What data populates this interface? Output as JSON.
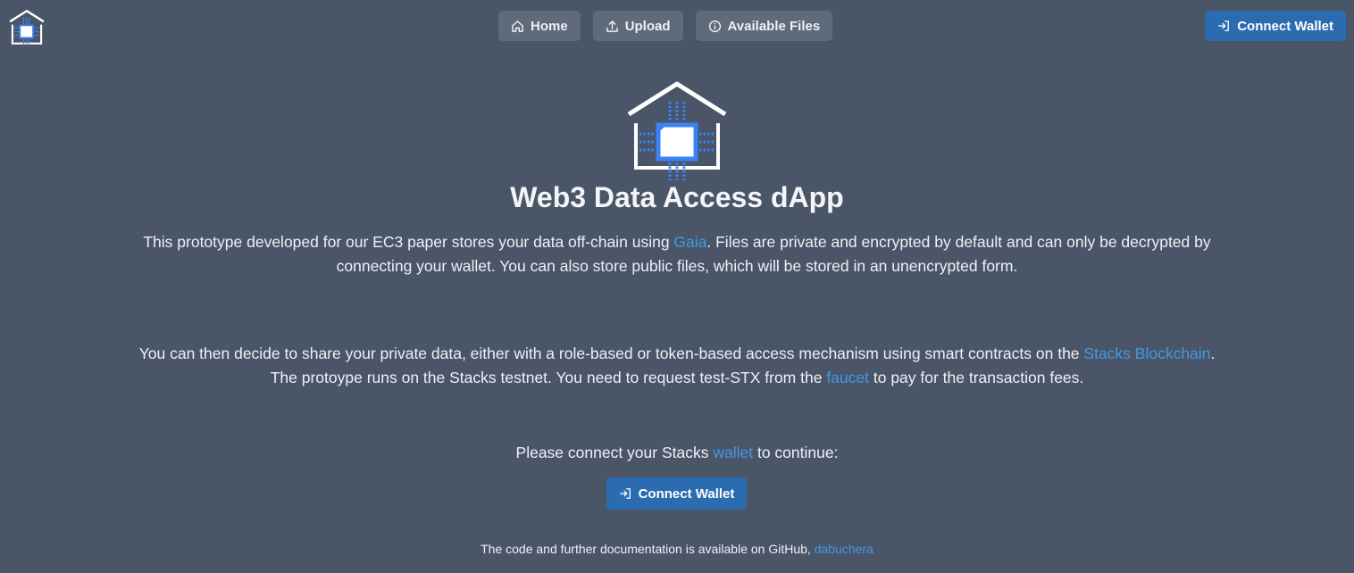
{
  "nav": {
    "home_label": "Home",
    "upload_label": "Upload",
    "files_label": "Available Files",
    "connect_label": "Connect Wallet"
  },
  "hero": {
    "title": "Web3 Data Access dApp",
    "p1_a": "This prototype developed for our EC3 paper stores your data off-chain using ",
    "p1_link": "Gaia",
    "p1_b": ". Files are private and encrypted by default and can only be decrypted by",
    "p1_c": "connecting your wallet. You can also store public files, which will be stored in an unencrypted form.",
    "p2_a": "You can then decide to share your private data, either with a role-based or token-based access mechanism using smart contracts on the ",
    "p2_link": "Stacks Blockchain",
    "p2_b": ".",
    "p2_c": "The protoype runs on the Stacks testnet. You need to request test-STX from the ",
    "p2_link2": "faucet",
    "p2_d": " to pay for the transaction fees.",
    "p3_a": "Please connect your Stacks ",
    "p3_link": "wallet",
    "p3_b": " to continue:",
    "connect_label": "Connect Wallet"
  },
  "footer": {
    "text": "The code and further documentation is available on GitHub, ",
    "link": "dabuchera"
  },
  "colors": {
    "background": "#4a5568",
    "button": "#5f6a7a",
    "accent": "#2b6cb0",
    "link": "#4299e1"
  },
  "icons": [
    "house-chip-logo",
    "home-icon",
    "upload-icon",
    "info-icon",
    "login-icon"
  ]
}
